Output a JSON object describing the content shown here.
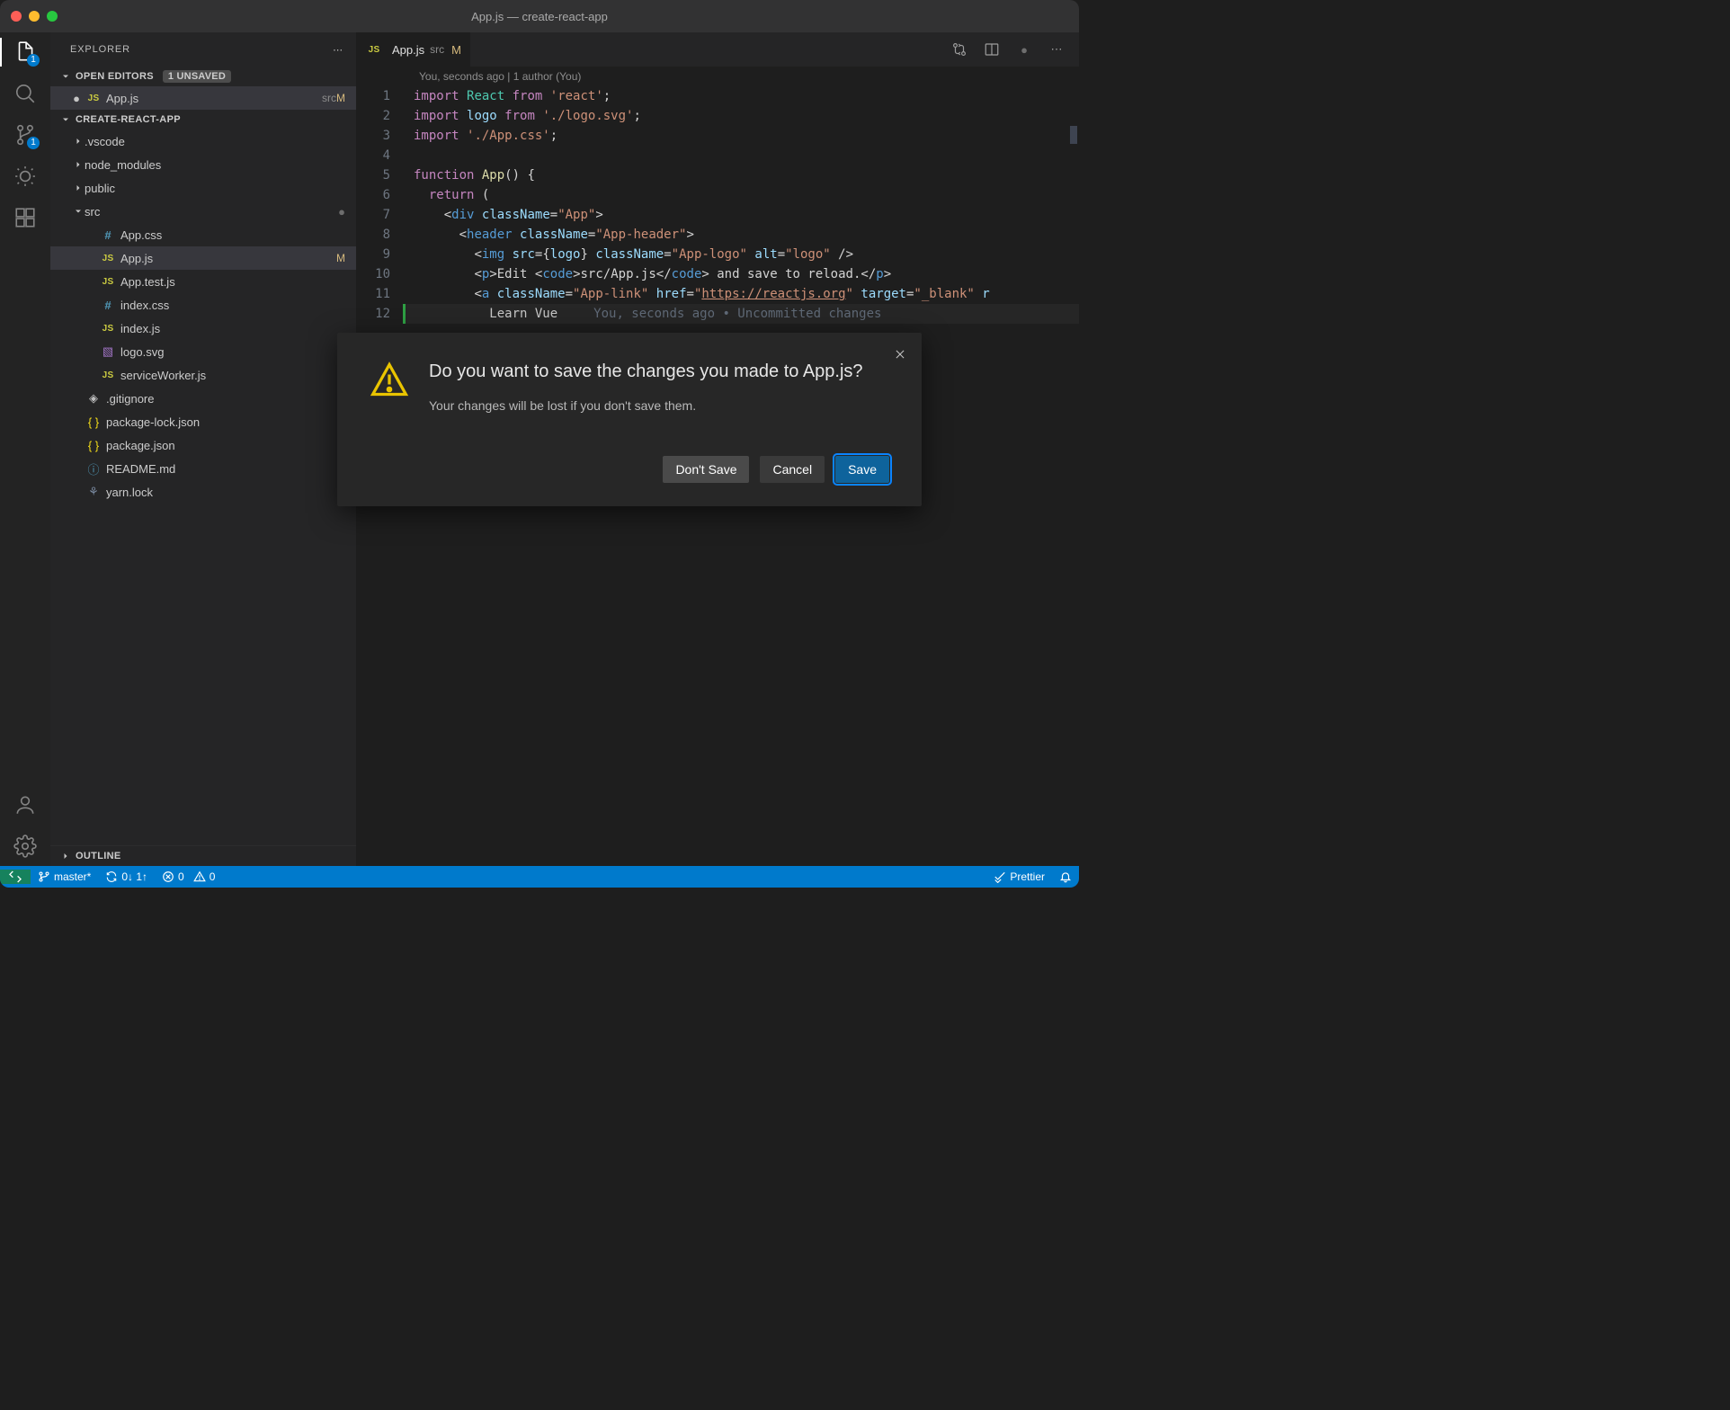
{
  "title": "App.js — create-react-app",
  "activitybar": {
    "explorer_badge": "1",
    "scm_badge": "1"
  },
  "sidebar": {
    "title": "EXPLORER",
    "open_editors_label": "OPEN EDITORS",
    "unsaved_badge": "1 UNSAVED",
    "open_editors": [
      {
        "name": "App.js",
        "dir": "src",
        "mod": "M",
        "dirty": true
      }
    ],
    "project_name": "CREATE-REACT-APP",
    "tree": [
      {
        "depth": 1,
        "kind": "folder",
        "name": ".vscode"
      },
      {
        "depth": 1,
        "kind": "folder",
        "name": "node_modules"
      },
      {
        "depth": 1,
        "kind": "folder",
        "name": "public"
      },
      {
        "depth": 1,
        "kind": "folder",
        "name": "src",
        "expanded": true,
        "status_dot": true
      },
      {
        "depth": 2,
        "kind": "file",
        "icon": "css",
        "name": "App.css"
      },
      {
        "depth": 2,
        "kind": "file",
        "icon": "js",
        "name": "App.js",
        "selected": true,
        "mod": "M"
      },
      {
        "depth": 2,
        "kind": "file",
        "icon": "js",
        "name": "App.test.js"
      },
      {
        "depth": 2,
        "kind": "file",
        "icon": "css",
        "name": "index.css"
      },
      {
        "depth": 2,
        "kind": "file",
        "icon": "js",
        "name": "index.js"
      },
      {
        "depth": 2,
        "kind": "file",
        "icon": "svg",
        "name": "logo.svg"
      },
      {
        "depth": 2,
        "kind": "file",
        "icon": "js",
        "name": "serviceWorker.js"
      },
      {
        "depth": 1,
        "kind": "file",
        "icon": "git",
        "name": ".gitignore"
      },
      {
        "depth": 1,
        "kind": "file",
        "icon": "json",
        "name": "package-lock.json"
      },
      {
        "depth": 1,
        "kind": "file",
        "icon": "json",
        "name": "package.json"
      },
      {
        "depth": 1,
        "kind": "file",
        "icon": "md",
        "name": "README.md"
      },
      {
        "depth": 1,
        "kind": "file",
        "icon": "lock",
        "name": "yarn.lock"
      }
    ],
    "outline_label": "OUTLINE"
  },
  "editor": {
    "tab": {
      "fname": "App.js",
      "fpath": "src",
      "mod": "M"
    },
    "blame_header": "You, seconds ago | 1 author (You)",
    "line_numbers": [
      "1",
      "2",
      "3",
      "4",
      "5",
      "6",
      "7",
      "8",
      "9",
      "10",
      "11",
      "12"
    ],
    "lines_html": [
      "<span class='tok-kw'>import</span> <span class='tok-id2'>React</span> <span class='tok-kw'>from</span> <span class='tok-str'>'react'</span><span class='tok-pun'>;</span>",
      "<span class='tok-kw'>import</span> <span class='tok-id'>logo</span> <span class='tok-kw'>from</span> <span class='tok-str'>'./logo.svg'</span><span class='tok-pun'>;</span>",
      "<span class='tok-kw'>import</span> <span class='tok-str'>'./App.css'</span><span class='tok-pun'>;</span>",
      "",
      "<span class='tok-kw'>function</span> <span class='tok-fn'>App</span><span class='tok-pun'>() {</span>",
      "  <span class='tok-kw'>return</span> <span class='tok-pun'>(</span>",
      "    <span class='tok-pun'>&lt;</span><span class='tok-tag'>div</span> <span class='tok-attr'>className</span><span class='tok-pun'>=</span><span class='tok-str'>\"App\"</span><span class='tok-pun'>&gt;</span>",
      "      <span class='tok-pun'>&lt;</span><span class='tok-tag'>header</span> <span class='tok-attr'>className</span><span class='tok-pun'>=</span><span class='tok-str'>\"App-header\"</span><span class='tok-pun'>&gt;</span>",
      "        <span class='tok-pun'>&lt;</span><span class='tok-tag'>img</span> <span class='tok-attr'>src</span><span class='tok-pun'>={</span><span class='tok-id'>logo</span><span class='tok-pun'>}</span> <span class='tok-attr'>className</span><span class='tok-pun'>=</span><span class='tok-str'>\"App-logo\"</span> <span class='tok-attr'>alt</span><span class='tok-pun'>=</span><span class='tok-str'>\"logo\"</span> <span class='tok-pun'>/&gt;</span>",
      "        <span class='tok-pun'>&lt;</span><span class='tok-tag'>p</span><span class='tok-pun'>&gt;</span><span class='tok-plain'>Edit </span><span class='tok-pun'>&lt;</span><span class='tok-tag'>code</span><span class='tok-pun'>&gt;</span><span class='tok-plain'>src/App.js</span><span class='tok-pun'>&lt;/</span><span class='tok-tag'>code</span><span class='tok-pun'>&gt;</span><span class='tok-plain'> and save to reload.</span><span class='tok-pun'>&lt;/</span><span class='tok-tag'>p</span><span class='tok-pun'>&gt;</span>",
      "        <span class='tok-pun'>&lt;</span><span class='tok-tag'>a</span> <span class='tok-attr'>className</span><span class='tok-pun'>=</span><span class='tok-str'>\"App-link\"</span> <span class='tok-attr'>href</span><span class='tok-pun'>=</span><span class='tok-str'>\"<u>https://reactjs.org</u>\"</span> <span class='tok-attr'>target</span><span class='tok-pun'>=</span><span class='tok-str'>\"_blank\"</span> <span class='tok-attr'>r</span>",
      "          <span class='tok-plain'>Learn Vue</span><span class='blame-inline'>You, seconds ago • Uncommitted changes</span>"
    ]
  },
  "dialog": {
    "title": "Do you want to save the changes you made to App.js?",
    "subtitle": "Your changes will be lost if you don't save them.",
    "buttons": {
      "dont_save": "Don't Save",
      "cancel": "Cancel",
      "save": "Save"
    }
  },
  "statusbar": {
    "branch": "master*",
    "sync": "0↓ 1↑",
    "errors": "0",
    "warnings": "0",
    "prettier": "Prettier"
  }
}
